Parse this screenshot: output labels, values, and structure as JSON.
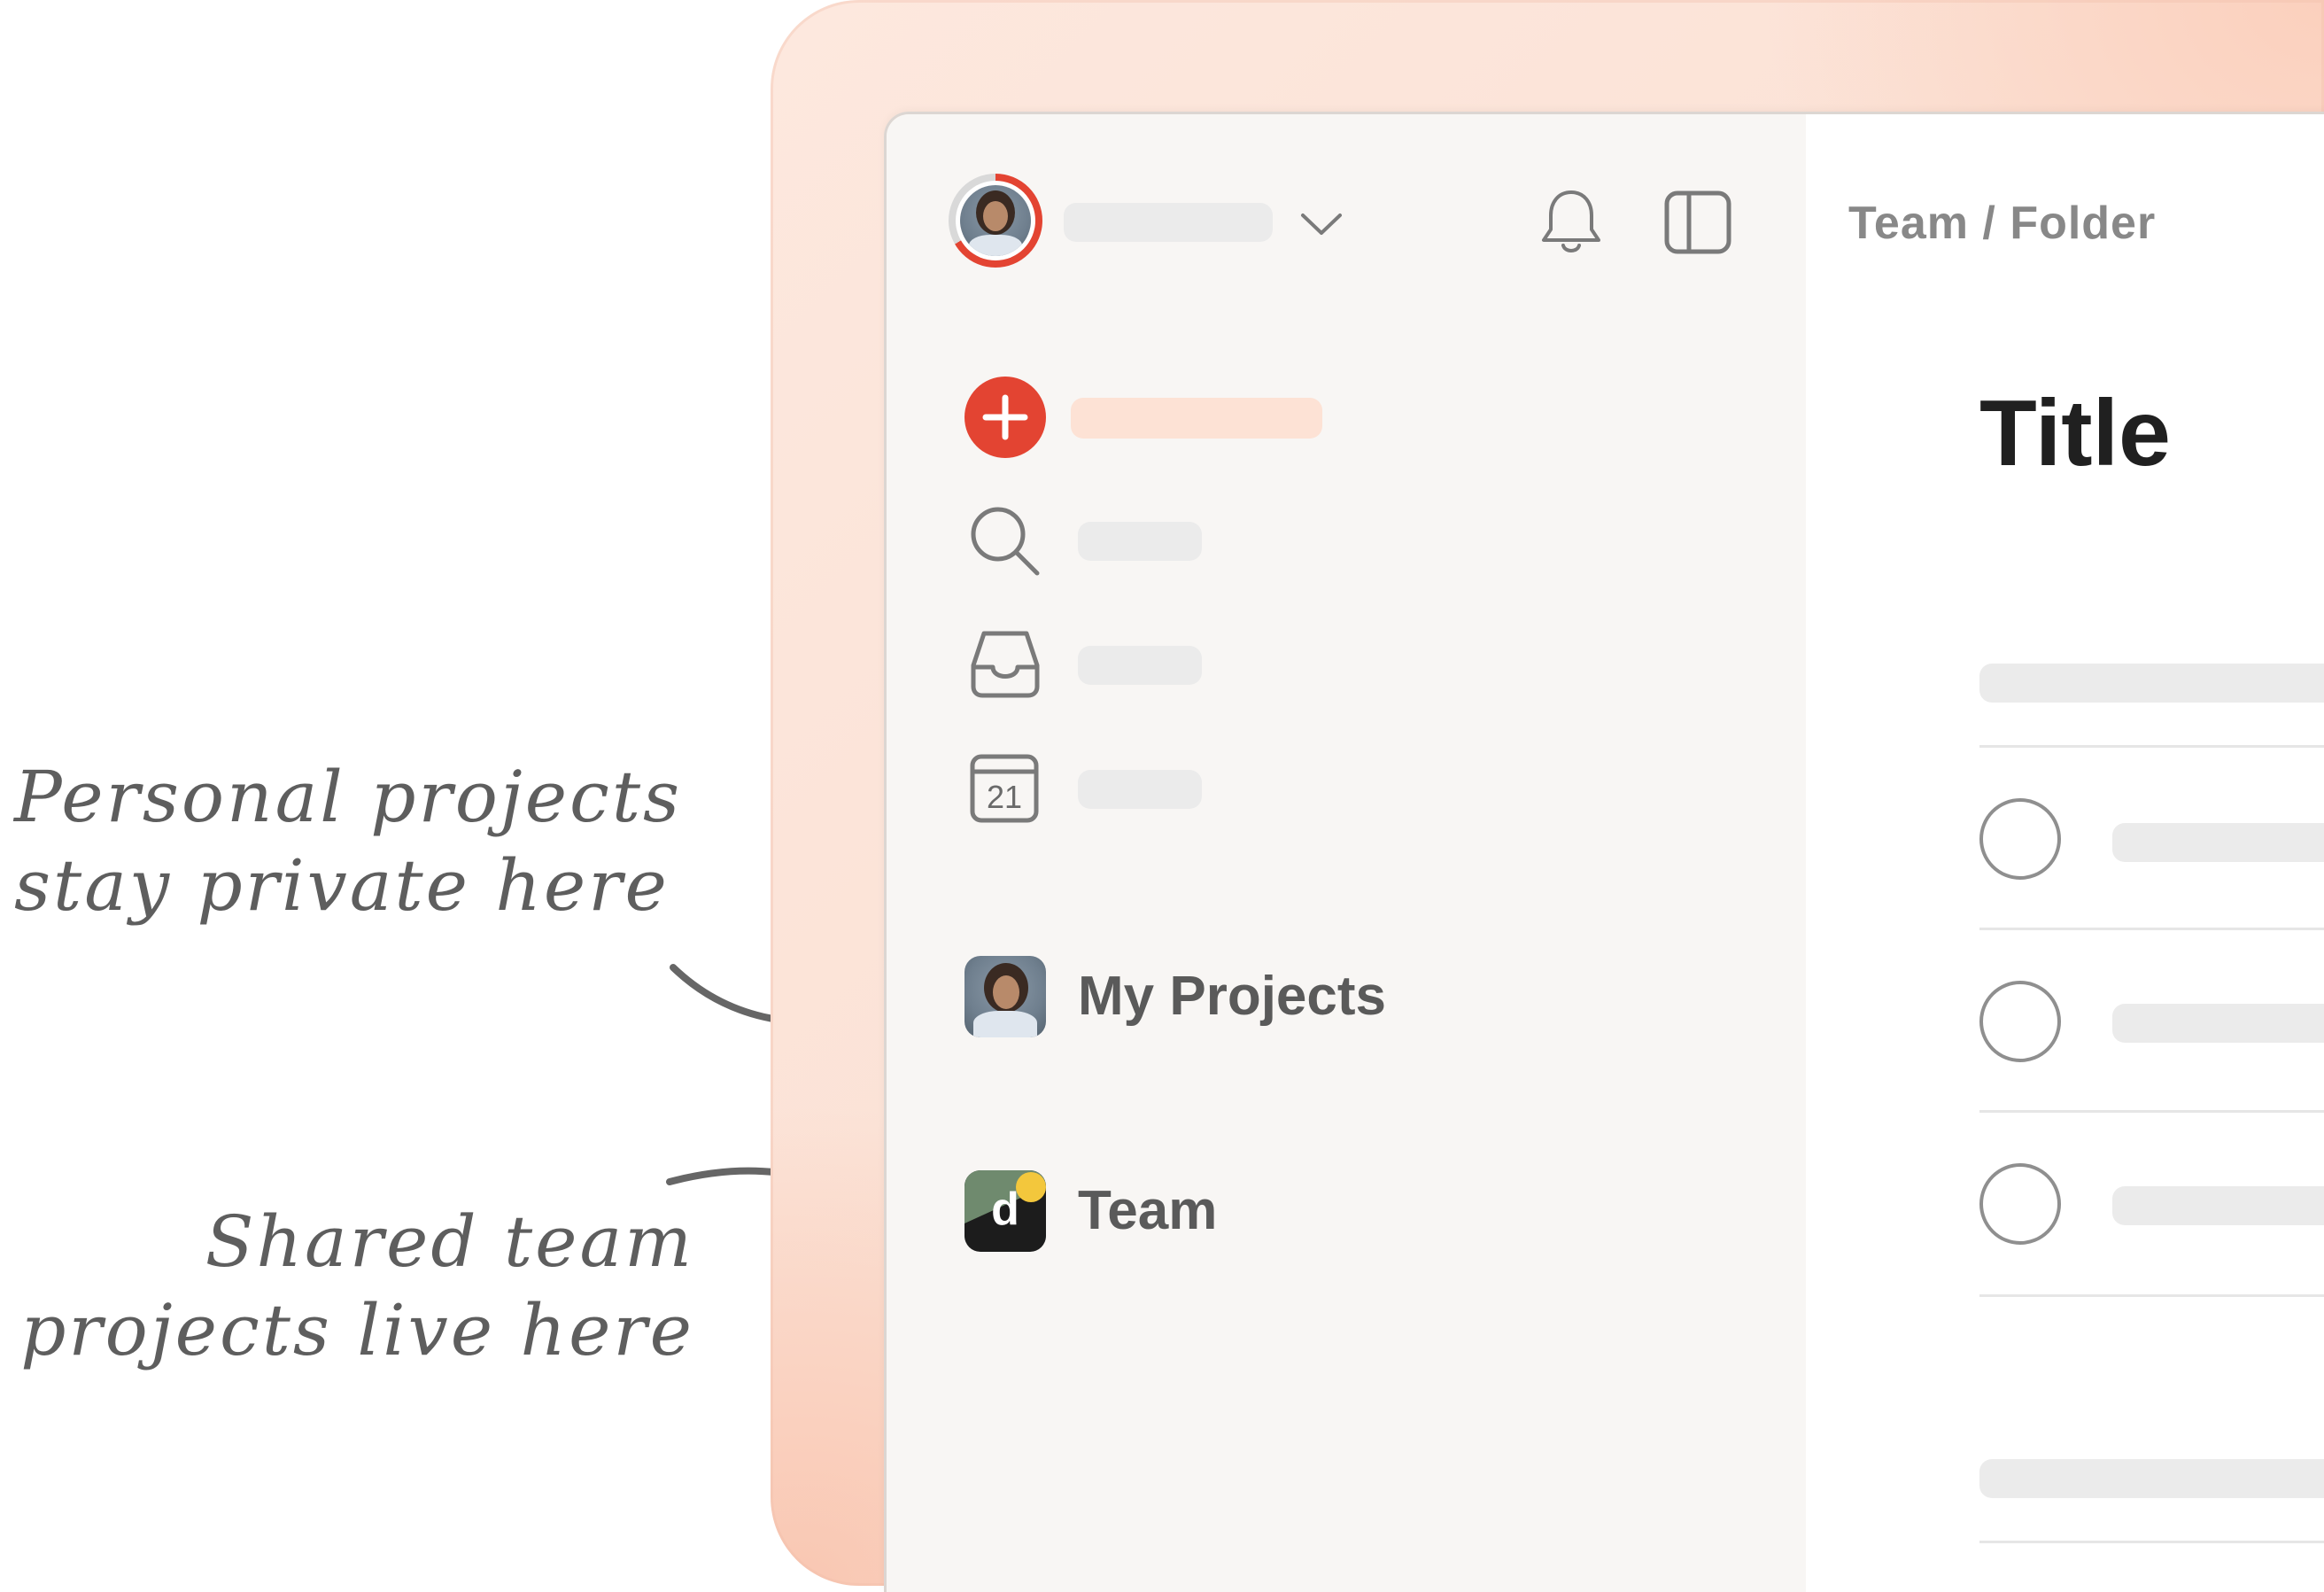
{
  "annotations": {
    "personal": [
      "Personal projects",
      "stay private here"
    ],
    "shared": [
      "Shared team",
      "projects live here"
    ]
  },
  "sidebar": {
    "projects": [
      {
        "label": "My Projects",
        "icon": "user-avatar-icon"
      },
      {
        "label": "Team",
        "icon": "team-logo-icon",
        "logo_letter": "d"
      }
    ],
    "calendar_day": "21"
  },
  "main": {
    "breadcrumb": "Team / Folder",
    "title": "Title"
  },
  "colors": {
    "accent": "#e34432",
    "placeholder": "#ebebeb",
    "highlight": "#fde2d5"
  }
}
